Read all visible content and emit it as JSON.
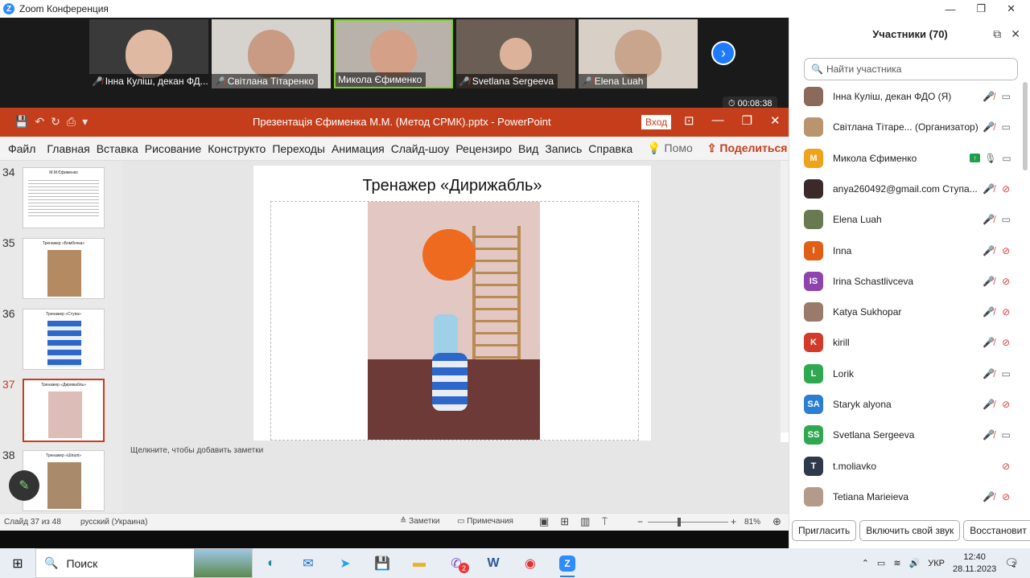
{
  "zoom": {
    "title": "Zoom Конференция",
    "timer": "00:08:38",
    "next_label": "›",
    "tiles": [
      {
        "name": "Інна Куліш, декан ФД..."
      },
      {
        "name": "Світлана Тітаренко"
      },
      {
        "name": "Микола Єфименко"
      },
      {
        "name": "Svetlana Sergeeva"
      },
      {
        "name": "Elena Luah"
      }
    ]
  },
  "ppt": {
    "title": "Презентація Єфименка М.М. (Метод СРМК).pptx  -  PowerPoint",
    "login": "Вход",
    "tabs": [
      "Файл",
      "Главная",
      "Вставка",
      "Рисование",
      "Конструкто",
      "Переходы",
      "Анимация",
      "Слайд-шоу",
      "Рецензиро",
      "Вид",
      "Запись",
      "Справка"
    ],
    "help_search": "Помо",
    "share": "Поделиться",
    "thumbs": [
      {
        "num": "34",
        "title": "М.М.Єфименко"
      },
      {
        "num": "35",
        "title": "Тренажер «Бомбочка»"
      },
      {
        "num": "36",
        "title": "Тренажер «Ступа»"
      },
      {
        "num": "37",
        "title": "Тренажер «Дирижабль»"
      },
      {
        "num": "38",
        "title": "Тренажер «Шпалі»"
      }
    ],
    "slide_title": "Тренажер «Дирижабль»",
    "notes_placeholder": "Щелкните, чтобы добавить заметки",
    "status": {
      "slide": "Слайд 37 из 48",
      "lang": "русский (Украина)",
      "notes": "Заметки",
      "comments": "Примечания",
      "zoom": "81%"
    }
  },
  "participants": {
    "header": "Участники (70)",
    "search_placeholder": "Найти участника",
    "list": [
      {
        "name": "Інна Куліш, декан ФДО (Я)",
        "initials": "",
        "color": "#8a6a5a",
        "mic": "off",
        "video": "on"
      },
      {
        "name": "Світлана Тітаре... (Организатор)",
        "initials": "",
        "color": "#b9946f",
        "mic": "off",
        "video": "on"
      },
      {
        "name": "Микола Єфименко",
        "initials": "M",
        "color": "#f0a21b",
        "mic": "on",
        "video": "on",
        "sharing": true
      },
      {
        "name": "anya260492@gmail.com Ступа...",
        "initials": "",
        "color": "#3a2a2a",
        "mic": "off",
        "video": "off"
      },
      {
        "name": "Elena Luah",
        "initials": "",
        "color": "#6a7a50",
        "mic": "off",
        "video": "on"
      },
      {
        "name": "Inna",
        "initials": "I",
        "color": "#e05e16",
        "mic": "off",
        "video": "off"
      },
      {
        "name": "Irina Schastlivceva",
        "initials": "IS",
        "color": "#8e44ad",
        "mic": "off",
        "video": "off"
      },
      {
        "name": "Katya Sukhopar",
        "initials": "",
        "color": "#9a7a6a",
        "mic": "off",
        "video": "off"
      },
      {
        "name": "kirill",
        "initials": "K",
        "color": "#d23a2a",
        "mic": "off",
        "video": "off"
      },
      {
        "name": "Lorik",
        "initials": "L",
        "color": "#2fa84f",
        "mic": "off",
        "video": "on"
      },
      {
        "name": "Staryk alyona",
        "initials": "SA",
        "color": "#2a7fd4",
        "mic": "off",
        "video": "off"
      },
      {
        "name": "Svetlana Sergeeva",
        "initials": "SS",
        "color": "#2fa84f",
        "mic": "off",
        "video": "on"
      },
      {
        "name": "t.moliavko",
        "initials": "T",
        "color": "#2e3a4a",
        "mic": "",
        "video": "off"
      },
      {
        "name": "Tetiana Marieieva",
        "initials": "",
        "color": "#b49a8a",
        "mic": "off",
        "video": "off"
      }
    ],
    "footer": [
      "Пригласить",
      "Включить свой звук",
      "Восстановит"
    ]
  },
  "taskbar": {
    "search": "Поиск",
    "lang": "УКР",
    "time": "12:40",
    "date": "28.11.2023",
    "notifications": "2",
    "viber_badge": "2"
  }
}
